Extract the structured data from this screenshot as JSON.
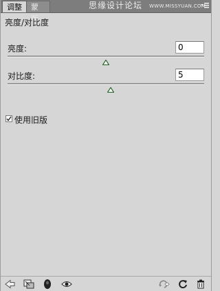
{
  "tabs": [
    {
      "label": "调整",
      "active": true
    },
    {
      "label": "蒙版",
      "active": false
    }
  ],
  "watermark": {
    "text": "思缘设计论坛",
    "url": "WWW.MISSYUAN.COM"
  },
  "panel": {
    "title": "亮度/对比度"
  },
  "brightness": {
    "label": "亮度:",
    "value": "0",
    "slider_fraction": 0.5
  },
  "contrast": {
    "label": "对比度:",
    "value": "5",
    "slider_fraction": 0.525
  },
  "legacy": {
    "label": "使用旧版",
    "checked": true
  },
  "toolbar": {
    "icons": [
      "back-arrow-icon",
      "clip-to-layer-icon",
      "mask-icon",
      "visibility-eye-icon",
      "view-previous-icon",
      "reset-icon",
      "delete-icon"
    ]
  },
  "colors": {
    "tabbar": "#7d7d7d",
    "panel": "#d6d6d6",
    "thumb": "#2e6b2e"
  }
}
